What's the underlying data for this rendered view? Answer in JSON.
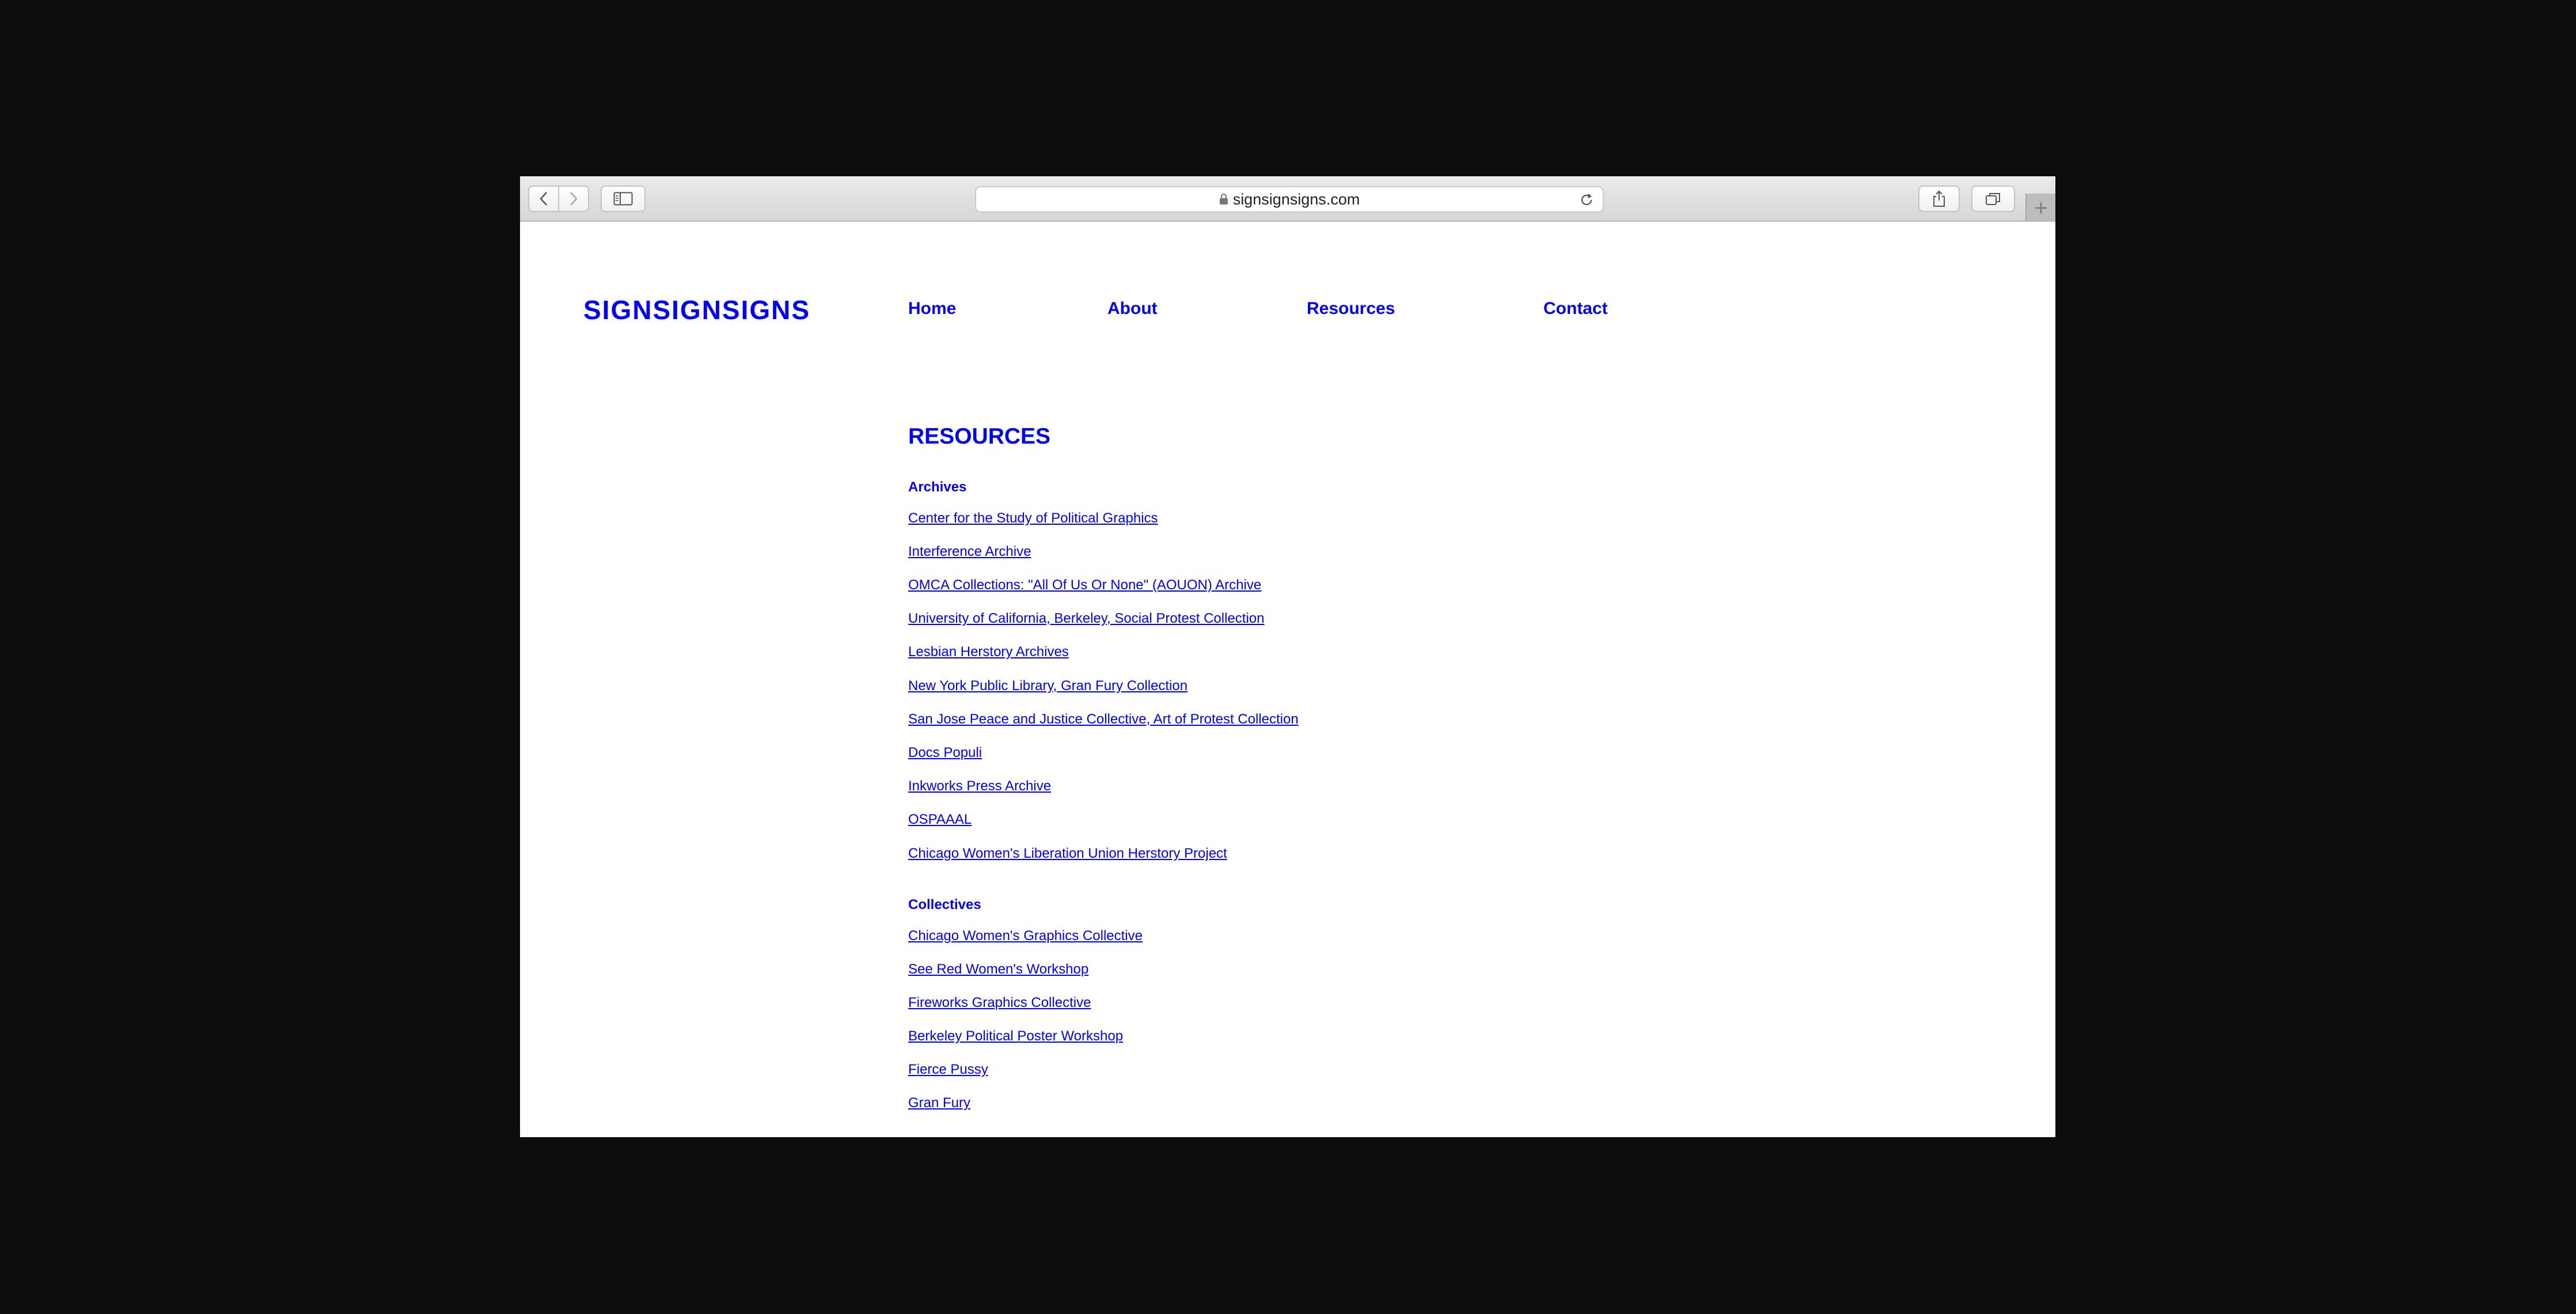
{
  "browser": {
    "url": "signsignsigns.com",
    "icons": {
      "back": "chevron-left-icon",
      "forward": "chevron-right-icon",
      "sidebar": "sidebar-icon",
      "lock": "lock-icon",
      "reload": "reload-icon",
      "share": "share-icon",
      "tabs": "tabs-icon",
      "new_tab": "plus-icon"
    }
  },
  "site": {
    "logo": "SIGNSIGNSIGNS",
    "nav": [
      "Home",
      "About",
      "Resources",
      "Contact"
    ],
    "accent_color": "#0000ff"
  },
  "main": {
    "title": "RESOURCES",
    "sections": [
      {
        "title": "Archives",
        "links": [
          "Center for the Study of Political Graphics",
          "Interference Archive",
          "OMCA Collections: \"All Of Us Or None\" (AOUON) Archive",
          "University of California, Berkeley, Social Protest Collection",
          "Lesbian Herstory Archives",
          "New York Public Library, Gran Fury Collection",
          "San Jose Peace and Justice Collective, Art of Protest Collection",
          "Docs Populi",
          "Inkworks Press Archive",
          "OSPAAAL",
          "Chicago Women's Liberation Union Herstory Project"
        ]
      },
      {
        "title": "Collectives",
        "links": [
          "Chicago Women's Graphics Collective",
          "See Red Women's Workshop",
          "Fireworks Graphics Collective",
          "Berkeley Political Poster Workshop",
          "Fierce Pussy",
          "Gran Fury"
        ]
      }
    ]
  }
}
